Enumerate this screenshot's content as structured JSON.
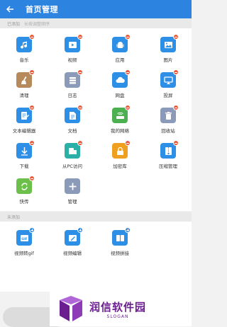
{
  "header": {
    "back_icon": "back-arrow-icon",
    "title": "首页管理",
    "bg": "#2c83e0"
  },
  "added": {
    "label": "已添加",
    "hint": "长按调整顺序",
    "items": [
      {
        "label": "音乐",
        "icon": "music-icon",
        "color": "#2e8fe6"
      },
      {
        "label": "视频",
        "icon": "video-icon",
        "color": "#2e8fe6"
      },
      {
        "label": "应用",
        "icon": "android-icon",
        "color": "#2e8fe6"
      },
      {
        "label": "图片",
        "icon": "image-icon",
        "color": "#2e8fe6"
      },
      {
        "label": "清理",
        "icon": "broom-icon",
        "color": "#b78a5c"
      },
      {
        "label": "日志",
        "icon": "log-stack-icon",
        "color": "#8a9ab8"
      },
      {
        "label": "网盘",
        "icon": "cloud-icon",
        "color": "#2e8fe6"
      },
      {
        "label": "投屏",
        "icon": "cast-icon",
        "color": "#2e8fe6"
      },
      {
        "label": "文本编辑器",
        "icon": "text-editor-icon",
        "color": "#2e8fe6"
      },
      {
        "label": "文档",
        "icon": "document-icon",
        "color": "#2e8fe6"
      },
      {
        "label": "我的网络",
        "icon": "router-icon",
        "color": "#4cb050"
      },
      {
        "label": "回收站",
        "icon": "trash-icon",
        "color": "#8a9ab8"
      },
      {
        "label": "下载",
        "icon": "download-icon",
        "color": "#2e8fe6"
      },
      {
        "label": "从PC访问",
        "icon": "pc-access-icon",
        "color": "#2bb0a8"
      },
      {
        "label": "加密库",
        "icon": "lock-safe-icon",
        "color": "#f0a020"
      },
      {
        "label": "压缩管理",
        "icon": "zip-icon",
        "color": "#2e8fe6"
      },
      {
        "label": "快传",
        "icon": "quick-transfer-icon",
        "color": "#6cc04a"
      },
      {
        "label": "管理",
        "icon": "plus-manage-icon",
        "color": "#8a9ab8"
      }
    ]
  },
  "not_added": {
    "label": "未添加",
    "items": [
      {
        "label": "视频转gif",
        "icon": "gif-icon",
        "color": "#2e8fe6"
      },
      {
        "label": "视频编辑",
        "icon": "video-edit-icon",
        "color": "#2e8fe6"
      },
      {
        "label": "视频拼接",
        "icon": "video-join-icon",
        "color": "#2e8fe6"
      }
    ]
  },
  "watermark": {
    "name": "润信软件园",
    "slogan": "SLOGAN",
    "color": "#6b1e90"
  }
}
